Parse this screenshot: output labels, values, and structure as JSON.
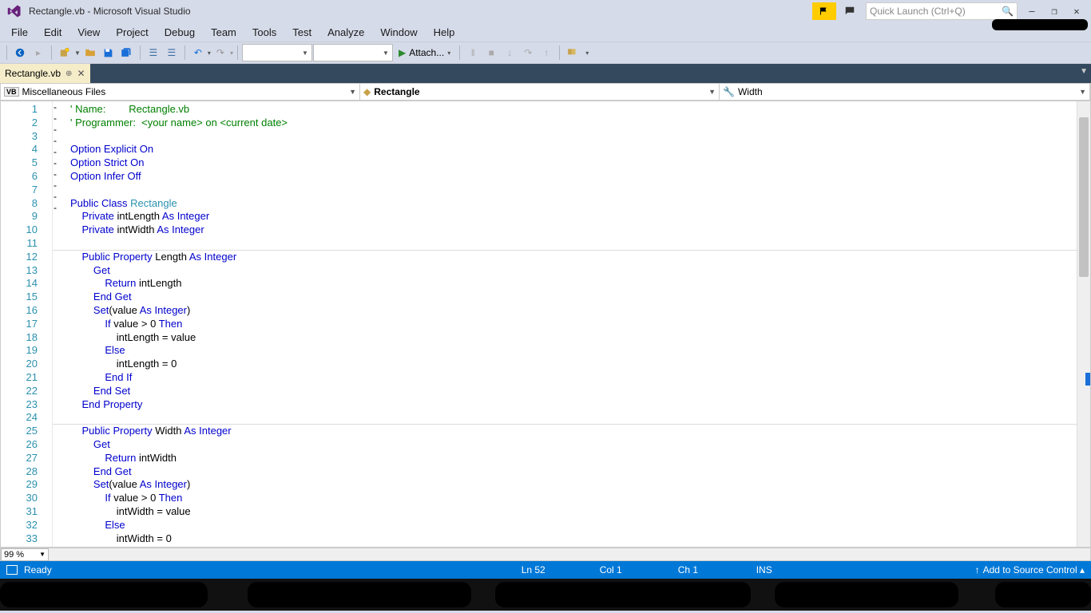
{
  "window": {
    "title": "Rectangle.vb - Microsoft Visual Studio"
  },
  "quicklaunch": {
    "placeholder": "Quick Launch (Ctrl+Q)"
  },
  "menu": {
    "items": [
      "File",
      "Edit",
      "View",
      "Project",
      "Debug",
      "Team",
      "Tools",
      "Test",
      "Analyze",
      "Window",
      "Help"
    ]
  },
  "toolbar": {
    "attach": "Attach..."
  },
  "tab": {
    "name": "Rectangle.vb"
  },
  "nav": {
    "scope": "Miscellaneous Files",
    "class": "Rectangle",
    "member": "Width"
  },
  "zoom": "99 %",
  "status": {
    "ready": "Ready",
    "ln": "Ln 52",
    "col": "Col 1",
    "ch": "Ch 1",
    "ins": "INS",
    "src": "Add to Source Control"
  },
  "code": {
    "lines": [
      {
        "n": 1,
        "fold": "-",
        "html": "<span class='cm'>' Name:        </span><span class='cm'>Rectangle.vb</span>"
      },
      {
        "n": 2,
        "html": "<span class='cm'>' Programmer:  &lt;your name&gt; on &lt;current date&gt;</span>"
      },
      {
        "n": 3,
        "html": ""
      },
      {
        "n": 4,
        "html": "<span class='kw'>Option Explicit On</span>"
      },
      {
        "n": 5,
        "html": "<span class='kw'>Option Strict On</span>"
      },
      {
        "n": 6,
        "html": "<span class='kw'>Option Infer Off</span>"
      },
      {
        "n": 7,
        "html": ""
      },
      {
        "n": 8,
        "fold": "-",
        "html": "<span class='kw'>Public Class</span> <span class='tp'>Rectangle</span>"
      },
      {
        "n": 9,
        "html": "    <span class='kw'>Private</span> intLength <span class='kw'>As Integer</span>"
      },
      {
        "n": 10,
        "html": "    <span class='kw'>Private</span> intWidth <span class='kw'>As Integer</span>"
      },
      {
        "n": 11,
        "hr": true,
        "html": ""
      },
      {
        "n": 12,
        "fold": "-",
        "html": "    <span class='kw'>Public Property</span> Length <span class='kw'>As Integer</span>"
      },
      {
        "n": 13,
        "fold": "-",
        "html": "        <span class='kw'>Get</span>"
      },
      {
        "n": 14,
        "html": "            <span class='kw'>Return</span> intLength"
      },
      {
        "n": 15,
        "html": "        <span class='kw'>End Get</span>"
      },
      {
        "n": 16,
        "fold": "-",
        "html": "        <span class='kw'>Set</span>(value <span class='kw'>As Integer</span>)"
      },
      {
        "n": 17,
        "html": "            <span class='kw'>If</span> value > 0 <span class='kw'>Then</span>"
      },
      {
        "n": 18,
        "fold": "-",
        "html": "                intLength = value"
      },
      {
        "n": 19,
        "html": "            <span class='kw'>Else</span>"
      },
      {
        "n": 20,
        "html": "                intLength = 0"
      },
      {
        "n": 21,
        "html": "            <span class='kw'>End If</span>"
      },
      {
        "n": 22,
        "html": "        <span class='kw'>End Set</span>"
      },
      {
        "n": 23,
        "html": "    <span class='kw'>End Property</span>"
      },
      {
        "n": 24,
        "hr": true,
        "html": ""
      },
      {
        "n": 25,
        "fold": "-",
        "html": "    <span class='kw'>Public Property</span> Width <span class='kw'>As Integer</span>"
      },
      {
        "n": 26,
        "fold": "-",
        "html": "        <span class='kw'>Get</span>"
      },
      {
        "n": 27,
        "html": "            <span class='kw'>Return</span> intWidth"
      },
      {
        "n": 28,
        "html": "        <span class='kw'>End Get</span>"
      },
      {
        "n": 29,
        "fold": "-",
        "html": "        <span class='kw'>Set</span>(value <span class='kw'>As Integer</span>)"
      },
      {
        "n": 30,
        "fold": "-",
        "html": "            <span class='kw'>If</span> value > 0 <span class='kw'>Then</span>"
      },
      {
        "n": 31,
        "html": "                intWidth = value"
      },
      {
        "n": 32,
        "html": "            <span class='kw'>Else</span>"
      },
      {
        "n": 33,
        "html": "                intWidth = 0"
      }
    ]
  }
}
